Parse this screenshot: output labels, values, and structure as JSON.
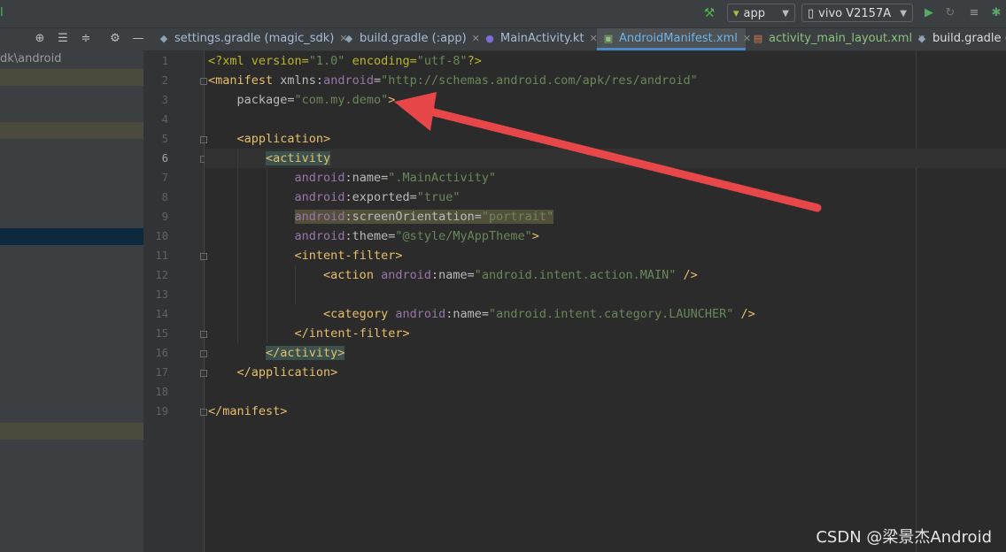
{
  "toolbar": {
    "left_glyph": "Ⅰ",
    "run_config": "app",
    "device": "vivo V2157A",
    "icons": [
      "hammer-icon",
      "android-icon",
      "phone-icon",
      "run-icon",
      "rerun-icon",
      "apply-changes-icon",
      "bug-icon"
    ]
  },
  "project_tools": [
    "locate-icon",
    "expand-all-icon",
    "collapse-all-icon",
    "gear-icon",
    "minimize-icon"
  ],
  "tabs": [
    {
      "label": "settings.gradle (magic_sdk)",
      "icon": "gradle-icon"
    },
    {
      "label": "build.gradle (:app)",
      "icon": "gradle-icon"
    },
    {
      "label": "MainActivity.kt",
      "icon": "kotlin-icon"
    },
    {
      "label": "AndroidManifest.xml",
      "icon": "manifest-icon",
      "active": true
    },
    {
      "label": "activity_main_layout.xml",
      "icon": "layout-icon"
    },
    {
      "label": "build.gradle (n",
      "icon": "gradle-icon"
    }
  ],
  "project_panel": {
    "path": "dk\\android"
  },
  "editor": {
    "line_numbers": [
      "1",
      "2",
      "3",
      "4",
      "5",
      "6",
      "7",
      "8",
      "9",
      "10",
      "11",
      "12",
      "13",
      "14",
      "15",
      "16",
      "17",
      "18",
      "19"
    ],
    "current_line": "6",
    "lines": [
      [
        {
          "t": "<?xml version=",
          "c": "t-pi"
        },
        {
          "t": "\"1.0\"",
          "c": "t-val"
        },
        {
          "t": " encoding=",
          "c": "t-pi"
        },
        {
          "t": "\"utf-8\"",
          "c": "t-val"
        },
        {
          "t": "?>",
          "c": "t-pi"
        }
      ],
      [
        {
          "t": "<manifest ",
          "c": "t-tag"
        },
        {
          "t": "xmlns:",
          "c": "t-attr"
        },
        {
          "t": "android",
          "c": "t-ns"
        },
        {
          "t": "=",
          "c": "t-attr"
        },
        {
          "t": "\"http://schemas.android.com/apk/res/android\"",
          "c": "t-val"
        }
      ],
      [
        {
          "t": "    package",
          "c": "t-attr"
        },
        {
          "t": "=",
          "c": "t-attr"
        },
        {
          "t": "\"com.my.demo\"",
          "c": "t-val"
        },
        {
          "t": ">",
          "c": "t-tag"
        }
      ],
      [],
      [
        {
          "t": "    ",
          "c": "t-plain"
        },
        {
          "t": "<application>",
          "c": "t-tag"
        }
      ],
      [
        {
          "t": "        ",
          "c": "t-plain"
        },
        {
          "t": "<activity",
          "c": "t-tag",
          "h": "tag-hl"
        }
      ],
      [
        {
          "t": "            ",
          "c": "t-plain"
        },
        {
          "t": "android",
          "c": "t-ns"
        },
        {
          "t": ":name=",
          "c": "t-attr"
        },
        {
          "t": "\".MainActivity\"",
          "c": "t-val"
        }
      ],
      [
        {
          "t": "            ",
          "c": "t-plain"
        },
        {
          "t": "android",
          "c": "t-ns"
        },
        {
          "t": ":exported=",
          "c": "t-attr"
        },
        {
          "t": "\"true\"",
          "c": "t-val"
        }
      ],
      [
        {
          "t": "            ",
          "c": "t-plain"
        },
        {
          "t": "android",
          "c": "t-ns",
          "h": "warn-hl"
        },
        {
          "t": ":screenOrientation=",
          "c": "t-attr",
          "h": "warn-hl"
        },
        {
          "t": "\"portrait\"",
          "c": "t-val",
          "h": "warn-hl"
        }
      ],
      [
        {
          "t": "            ",
          "c": "t-plain"
        },
        {
          "t": "android",
          "c": "t-ns"
        },
        {
          "t": ":theme=",
          "c": "t-attr"
        },
        {
          "t": "\"@style/MyAppTheme\"",
          "c": "t-val"
        },
        {
          "t": ">",
          "c": "t-tag"
        }
      ],
      [
        {
          "t": "            ",
          "c": "t-plain"
        },
        {
          "t": "<intent-filter>",
          "c": "t-tag"
        }
      ],
      [
        {
          "t": "                ",
          "c": "t-plain"
        },
        {
          "t": "<action ",
          "c": "t-tag"
        },
        {
          "t": "android",
          "c": "t-ns"
        },
        {
          "t": ":name=",
          "c": "t-attr"
        },
        {
          "t": "\"android.intent.action.MAIN\"",
          "c": "t-val"
        },
        {
          "t": " />",
          "c": "t-tag"
        }
      ],
      [],
      [
        {
          "t": "                ",
          "c": "t-plain"
        },
        {
          "t": "<category ",
          "c": "t-tag"
        },
        {
          "t": "android",
          "c": "t-ns"
        },
        {
          "t": ":name=",
          "c": "t-attr"
        },
        {
          "t": "\"android.intent.category.LAUNCHER\"",
          "c": "t-val"
        },
        {
          "t": " />",
          "c": "t-tag"
        }
      ],
      [
        {
          "t": "            ",
          "c": "t-plain"
        },
        {
          "t": "</intent-filter>",
          "c": "t-tag"
        }
      ],
      [
        {
          "t": "        ",
          "c": "t-plain"
        },
        {
          "t": "</activity>",
          "c": "t-tag",
          "h": "tag-hl"
        }
      ],
      [
        {
          "t": "    ",
          "c": "t-plain"
        },
        {
          "t": "</application>",
          "c": "t-tag"
        }
      ],
      [],
      [
        {
          "t": "</manifest>",
          "c": "t-tag"
        }
      ]
    ]
  },
  "colors": {
    "arrow": "#e8474a",
    "accent": "#4a88c7"
  },
  "watermark": "CSDN @梁景杰Android"
}
